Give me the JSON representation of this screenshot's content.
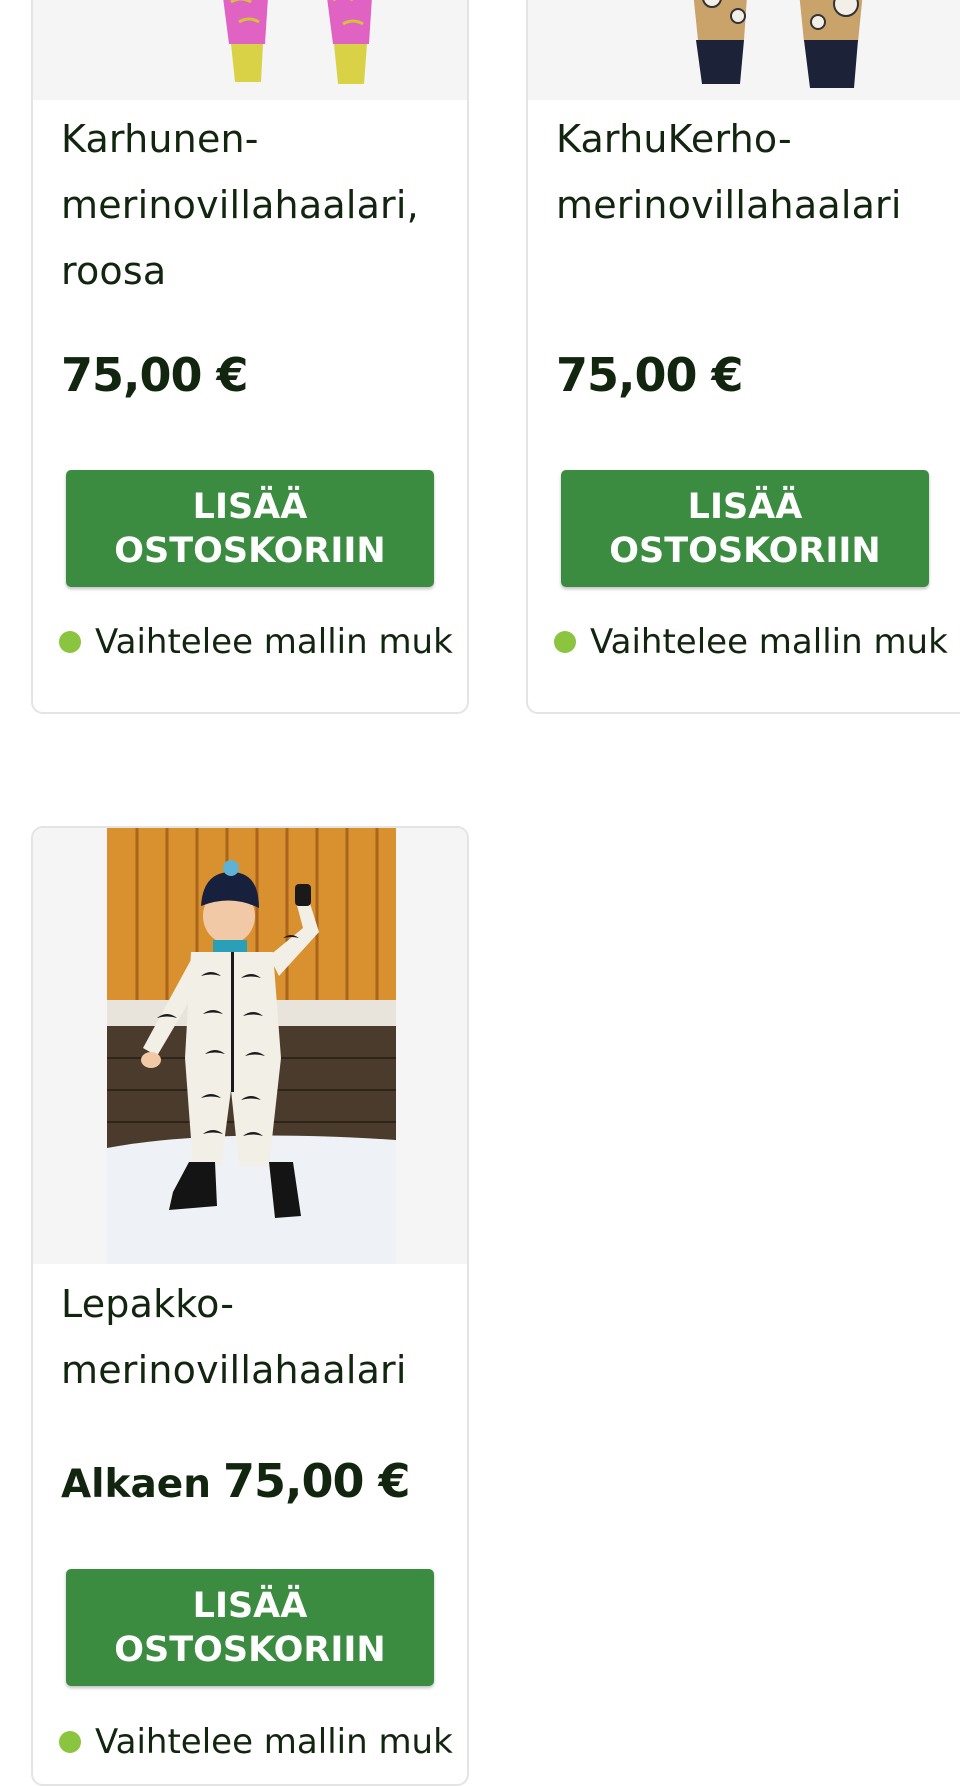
{
  "products": [
    {
      "name": "Karhunen-merinovillahaalari, roosa",
      "name_lines": [
        "Karhunen-",
        "merinovillahaalari,",
        "roosa"
      ],
      "price": "75,00 €",
      "add_to_cart": [
        "LISÄÄ",
        "OSTOSKORIIN"
      ],
      "stock": "Vaihtelee mallin muk"
    },
    {
      "name": "KarhuKerho-merinovillahaalari",
      "name_lines": [
        "KarhuKerho-",
        "merinovillahaalari"
      ],
      "price": "75,00 €",
      "add_to_cart": [
        "LISÄÄ",
        "OSTOSKORIIN"
      ],
      "stock": "Vaihtelee mallin muk"
    },
    {
      "name": "Lepakko-merinovillahaalari",
      "name_lines": [
        "Lepakko-",
        "merinovillahaalari"
      ],
      "price_prefix": "Alkaen",
      "price": "75,00 €",
      "add_to_cart": [
        "LISÄÄ",
        "OSTOSKORIIN"
      ],
      "stock": "Vaihtelee mallin muk"
    }
  ],
  "colors": {
    "button": "#3b8c40",
    "price_text": "#12250f",
    "stock_dot": "#8bc43f",
    "card_border": "#e4e4e4",
    "image_bg": "#f5f5f5"
  }
}
